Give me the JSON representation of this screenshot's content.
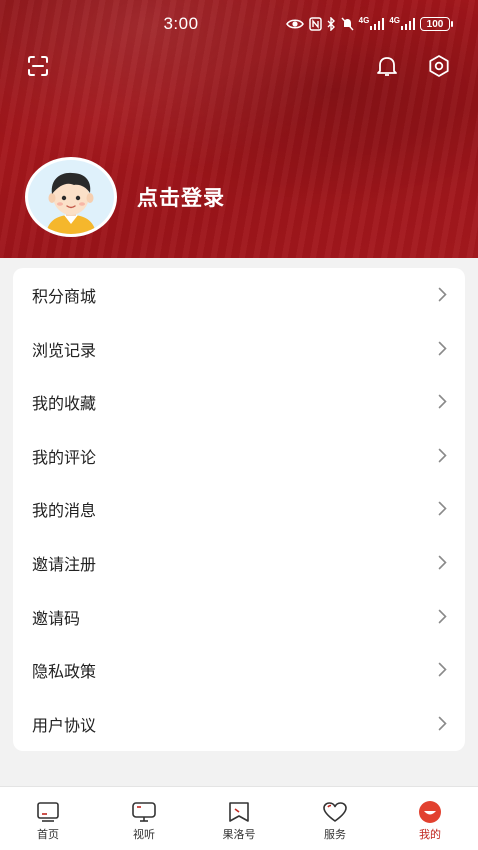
{
  "status_bar": {
    "time": "3:00",
    "signal1": "4G",
    "signal2": "4G",
    "battery": "100"
  },
  "header": {
    "login_text": "点击登录",
    "background_color": "#9c151a"
  },
  "menu": {
    "items": [
      {
        "label": "积分商城"
      },
      {
        "label": "浏览记录"
      },
      {
        "label": "我的收藏"
      },
      {
        "label": "我的评论"
      },
      {
        "label": "我的消息"
      },
      {
        "label": "邀请注册"
      },
      {
        "label": "邀请码"
      },
      {
        "label": "隐私政策"
      },
      {
        "label": "用户协议"
      }
    ]
  },
  "bottom_nav": {
    "items": [
      {
        "label": "首页",
        "icon": "home-icon"
      },
      {
        "label": "视听",
        "icon": "tv-icon"
      },
      {
        "label": "果洛号",
        "icon": "bookmark-icon"
      },
      {
        "label": "服务",
        "icon": "heart-icon"
      },
      {
        "label": "我的",
        "icon": "profile-icon",
        "active": true
      }
    ],
    "active_color": "#c0261f"
  }
}
